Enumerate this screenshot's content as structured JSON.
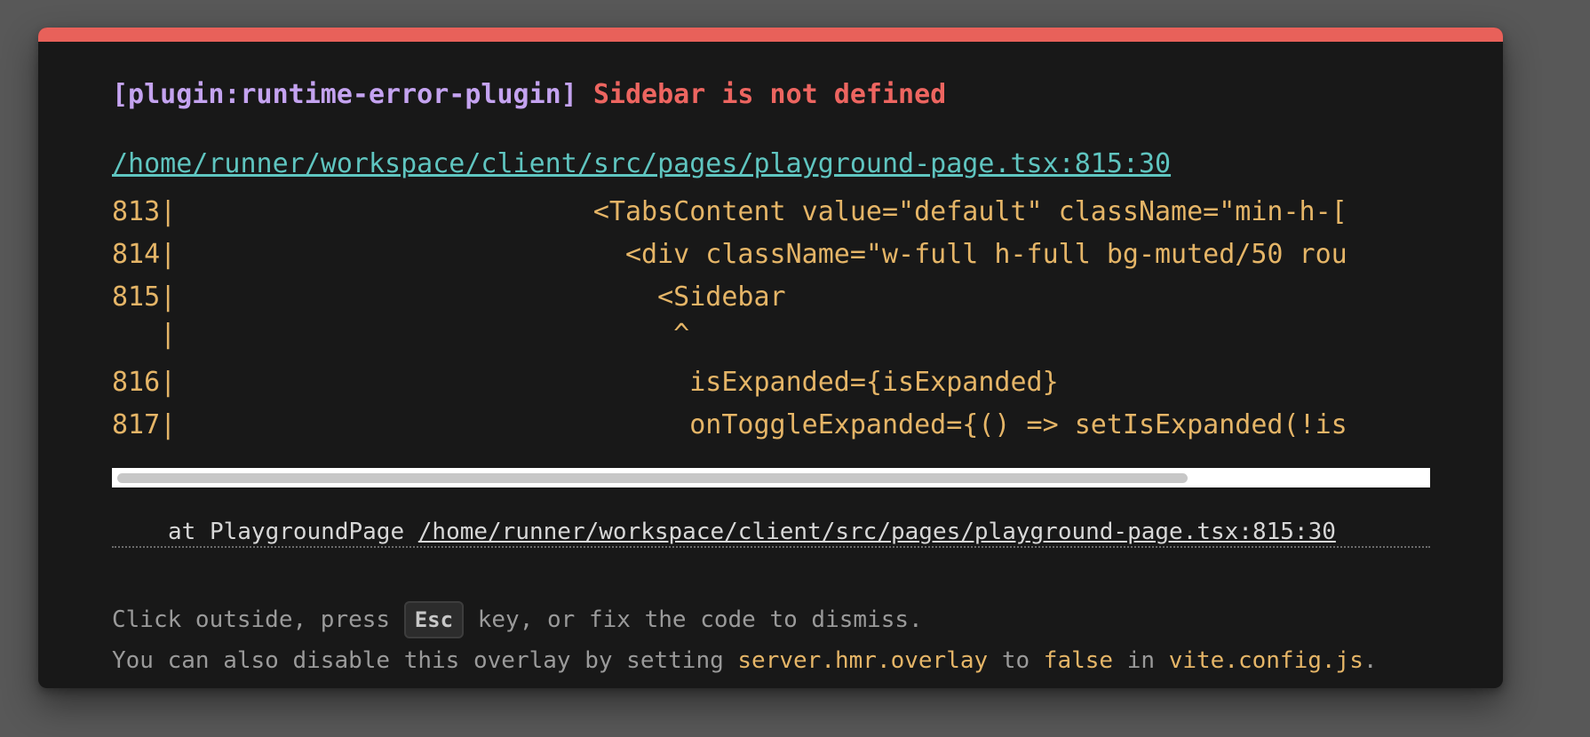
{
  "error": {
    "plugin": "[plugin:runtime-error-plugin]",
    "message": "Sidebar is not defined"
  },
  "file": {
    "path": "/home/runner/workspace/client/src/pages/playground-page.tsx:815:30"
  },
  "code_frame": [
    "813|                          <TabsContent value=\"default\" className=\"min-h-[",
    "814|                            <div className=\"w-full h-full bg-muted/50 rou",
    "815|                              <Sidebar",
    "   |                               ^",
    "816|                                isExpanded={isExpanded}",
    "817|                                onToggleExpanded={() => setIsExpanded(!is"
  ],
  "stack": {
    "prefix": "at PlaygroundPage ",
    "link": "/home/runner/workspace/client/src/pages/playground-page.tsx:815:30"
  },
  "tip": {
    "line1_before": "Click outside, press ",
    "key": "Esc",
    "line1_after": " key, or fix the code to dismiss.",
    "line2_part1": "You can also disable this overlay by setting ",
    "line2_code1": "server.hmr.overlay",
    "line2_part2": " to ",
    "line2_code2": "false",
    "line2_part3": " in ",
    "line2_code3": "vite.config.js",
    "line2_part4": "."
  },
  "colors": {
    "accent_bar": "#e8615a",
    "plugin_tag": "#c4a3f0",
    "error_message": "#ed6560",
    "file_link": "#5fc5c0",
    "code": "#e5b567"
  }
}
